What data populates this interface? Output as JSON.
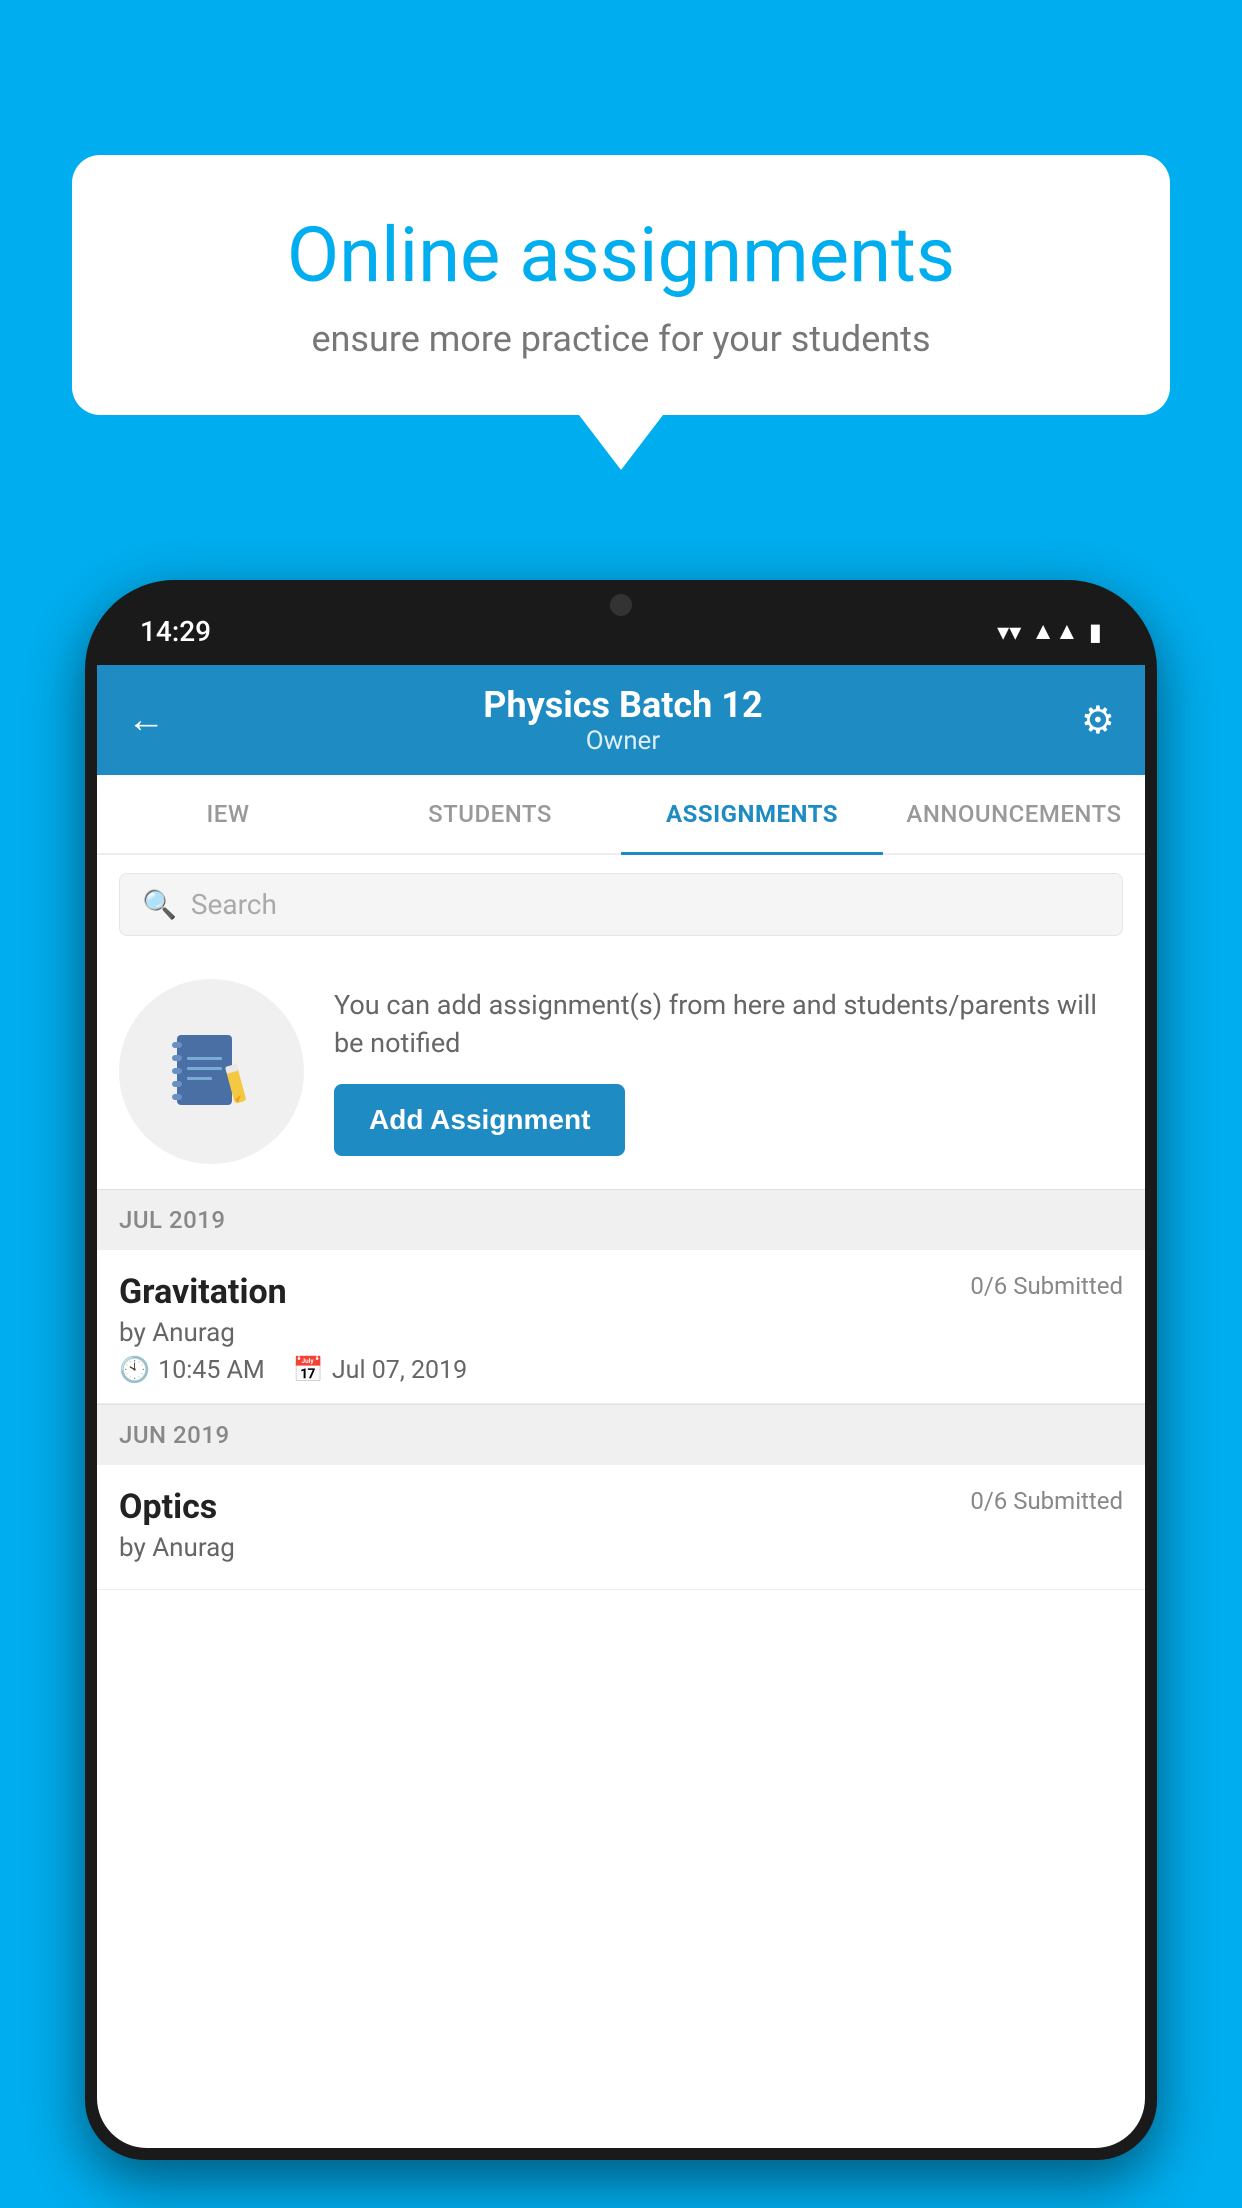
{
  "background_color": "#00AEEF",
  "speech_bubble": {
    "title": "Online assignments",
    "subtitle": "ensure more practice for your students"
  },
  "phone": {
    "status_bar": {
      "time": "14:29",
      "icons": [
        "wifi",
        "signal",
        "battery"
      ]
    },
    "header": {
      "title": "Physics Batch 12",
      "subtitle": "Owner",
      "back_label": "←",
      "settings_label": "⚙"
    },
    "tabs": [
      {
        "label": "IEW",
        "active": false
      },
      {
        "label": "STUDENTS",
        "active": false
      },
      {
        "label": "ASSIGNMENTS",
        "active": true
      },
      {
        "label": "ANNOUNCEMENTS",
        "active": false
      }
    ],
    "search": {
      "placeholder": "Search"
    },
    "info_card": {
      "description": "You can add assignment(s) from here and students/parents will be notified",
      "button_label": "Add Assignment"
    },
    "sections": [
      {
        "month_label": "JUL 2019",
        "assignments": [
          {
            "title": "Gravitation",
            "submitted": "0/6 Submitted",
            "author": "by Anurag",
            "time": "10:45 AM",
            "date": "Jul 07, 2019"
          }
        ]
      },
      {
        "month_label": "JUN 2019",
        "assignments": [
          {
            "title": "Optics",
            "submitted": "0/6 Submitted",
            "author": "by Anurag",
            "time": "",
            "date": ""
          }
        ]
      }
    ]
  }
}
